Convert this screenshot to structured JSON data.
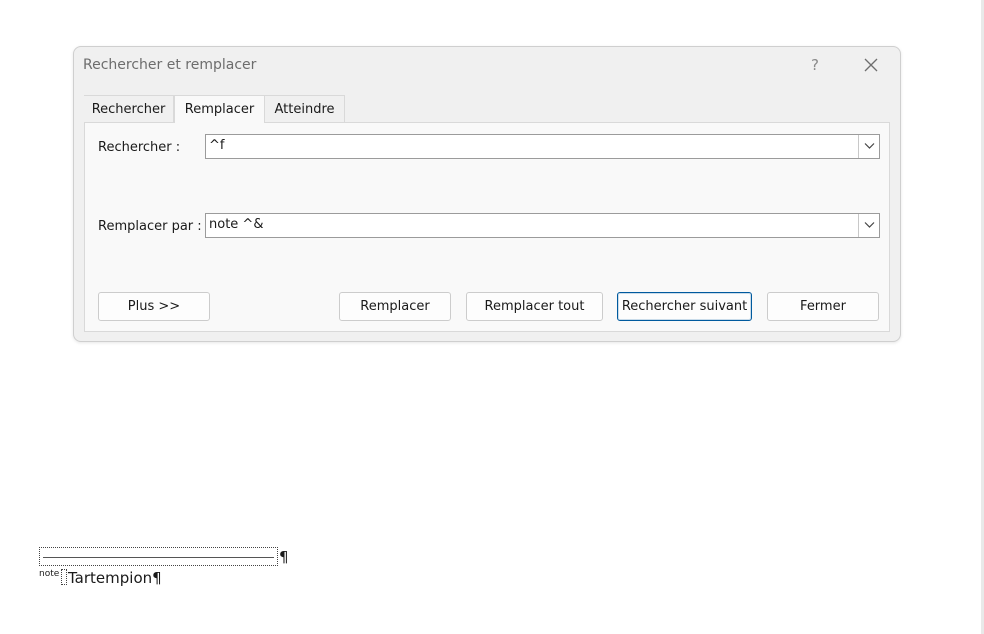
{
  "dialog": {
    "title": "Rechercher et remplacer",
    "help_label": "?",
    "close_icon": "close-icon"
  },
  "tabs": [
    {
      "label": "Rechercher",
      "mnemonic": "R",
      "active": false
    },
    {
      "label": "Remplacer",
      "mnemonic": "p",
      "active": true
    },
    {
      "label": "Atteindre",
      "mnemonic": "t",
      "active": false
    }
  ],
  "find": {
    "label": "Rechercher :",
    "value": "^f"
  },
  "replace": {
    "label": "Remplacer par :",
    "value": "note ^&"
  },
  "buttons": {
    "more": "Plus >>",
    "replace": "Remplacer",
    "replace_all": "Remplacer tout",
    "find_next": "Rechercher suivant",
    "close": "Fermer"
  },
  "document": {
    "pilcrow": "¶",
    "footnote_sup": "note",
    "footnote_text": "Tartempion",
    "footnote_pilcrow": "¶"
  },
  "colors": {
    "dialog_bg": "#f0f0f0",
    "panel_bg": "#f9f9f9",
    "default_button_border": "#005a9e"
  }
}
